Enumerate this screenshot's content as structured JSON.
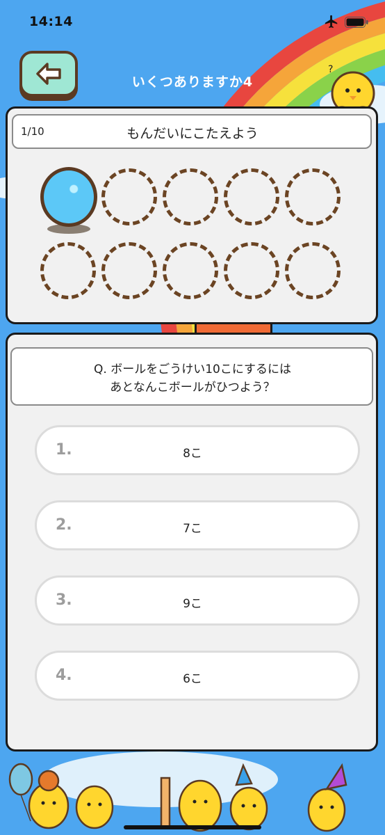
{
  "status": {
    "time": "14:14"
  },
  "header": {
    "title": "いくつありますか4"
  },
  "panel": {
    "counter": "1/10",
    "instruction": "もんだいにこたえよう",
    "filled_balls": 1,
    "total_slots": 10
  },
  "question": {
    "line1": "Q. ボールをごうけい10こにするには",
    "line2": "あとなんこボールがひつよう？"
  },
  "answers": [
    {
      "num": "1.",
      "label": "8こ"
    },
    {
      "num": "2.",
      "label": "7こ"
    },
    {
      "num": "3.",
      "label": "9こ"
    },
    {
      "num": "4.",
      "label": "6こ"
    }
  ],
  "colors": {
    "background": "#4da6f0",
    "back_button": "#9fe7d4",
    "ball": "#5cc8f7",
    "dashed_outline": "#6b4423",
    "stand": "#f06a35"
  },
  "icons": [
    "airplane-icon",
    "battery-icon",
    "back-arrow-icon",
    "chick-mascot-icon",
    "ball-icon"
  ]
}
